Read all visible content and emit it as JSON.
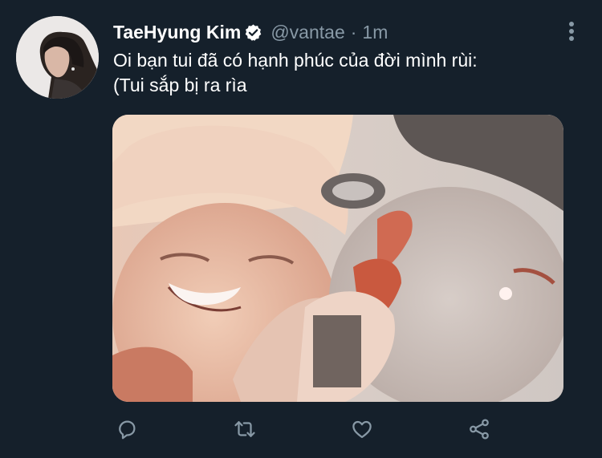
{
  "tweet": {
    "author_name": "TaeHyung Kim",
    "handle": "@vantae",
    "separator": "·",
    "time": "1m",
    "text": "Oi bạn tui đã có hạnh phúc của đời mình rùi:\n(Tui sắp bị ra rìa",
    "verified": true
  },
  "icons": {
    "verified": "verified-badge-icon",
    "more": "more-options-icon",
    "reply": "reply-icon",
    "retweet": "retweet-icon",
    "like": "like-heart-icon",
    "share": "share-icon"
  },
  "colors": {
    "background": "#15202b",
    "secondary_text": "#8899a6",
    "primary_text": "#ffffff"
  }
}
